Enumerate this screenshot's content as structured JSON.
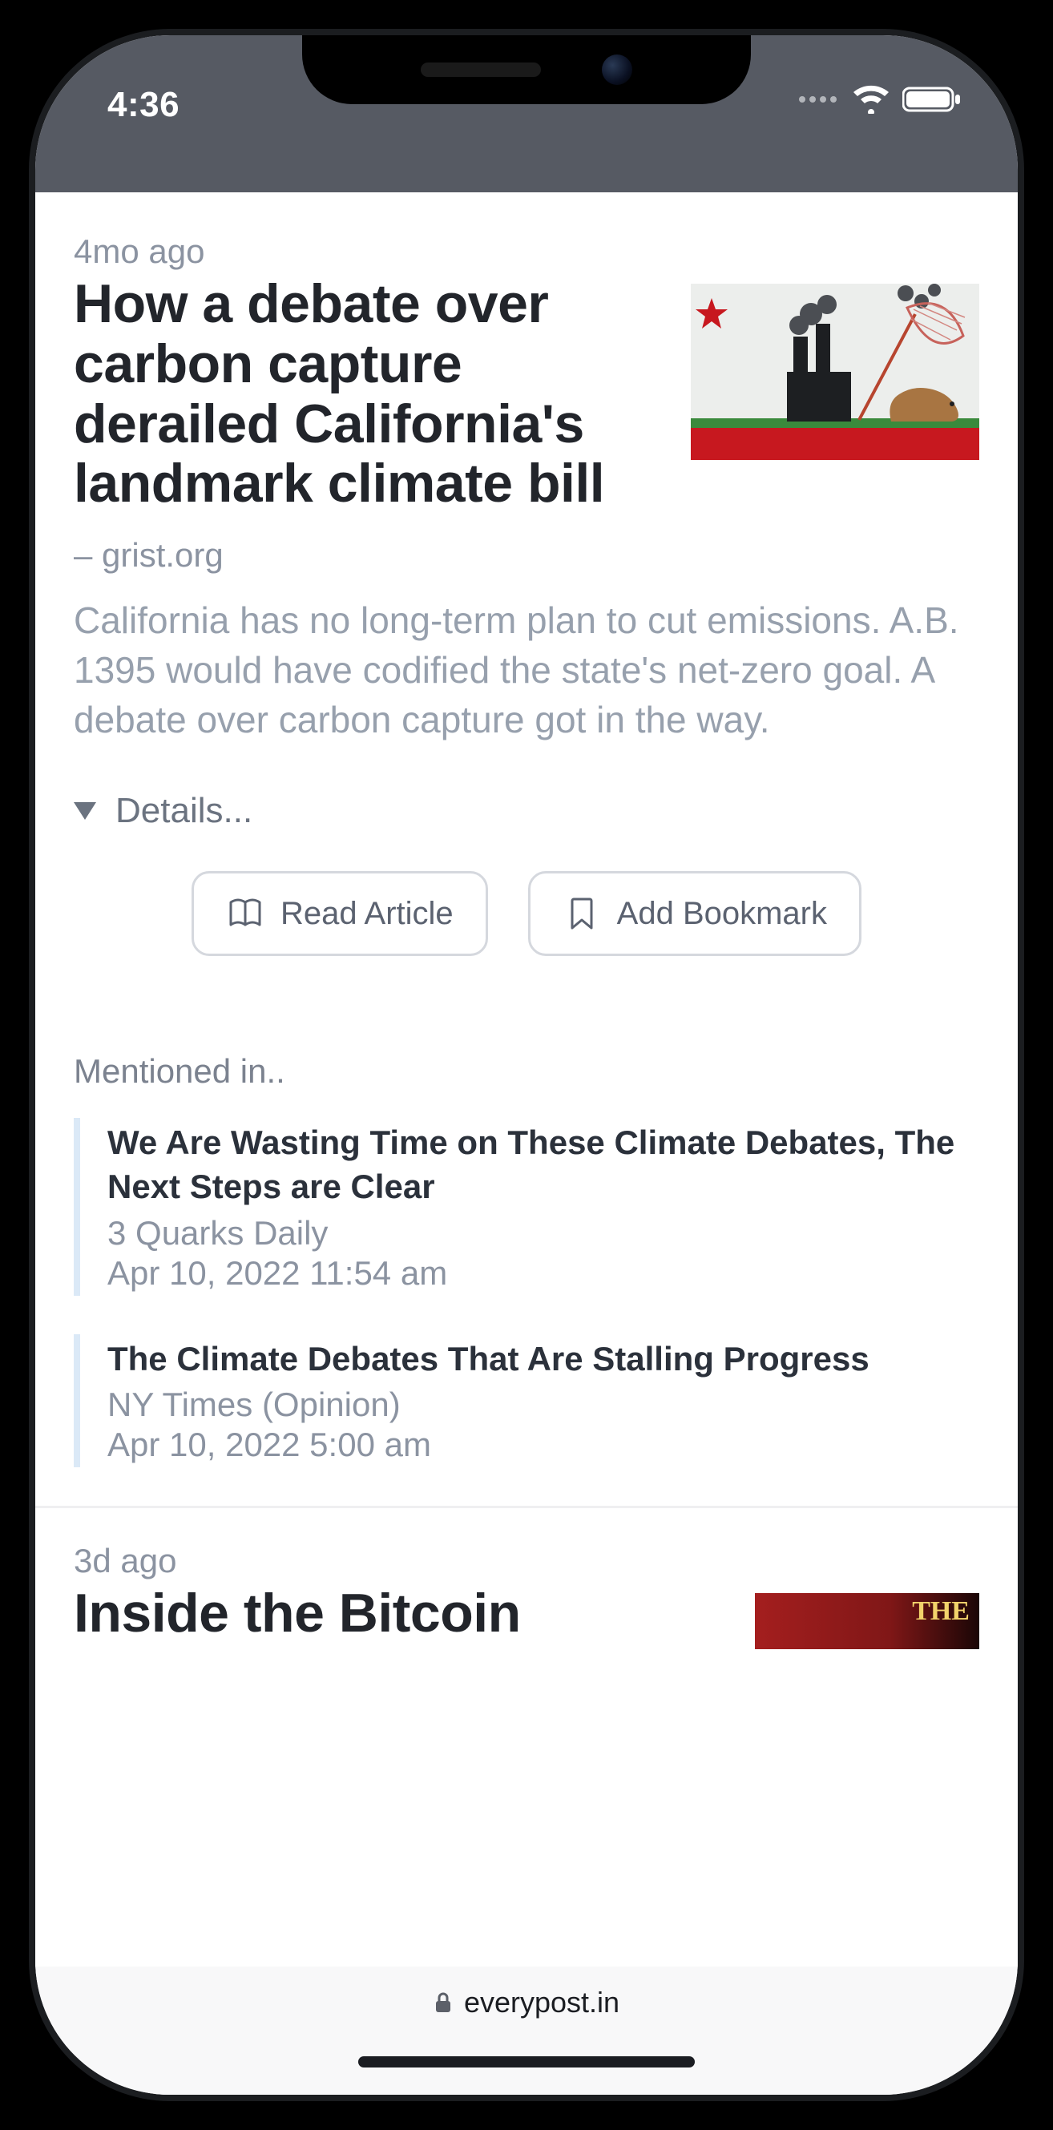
{
  "status": {
    "time": "4:36"
  },
  "article": {
    "age": "4mo ago",
    "headline": "How a debate over carbon capture derailed California's landmark climate bill",
    "source_prefix": "– ",
    "source": "grist.org",
    "summary": "California has no long-term plan to cut emissions. A.B. 1395 would have codified the state's net-zero goal. A debate over carbon capture got in the way.",
    "details_label": "Details...",
    "actions": {
      "read": "Read Article",
      "bookmark": "Add Bookmark"
    }
  },
  "mentions": {
    "section_label": "Mentioned in..",
    "items": [
      {
        "title": "We Are Wasting Time on These Climate Debates, The Next Steps are Clear",
        "source": "3 Quarks Daily",
        "timestamp": "Apr 10, 2022 11:54 am"
      },
      {
        "title": "The Climate Debates That Are Stalling Progress",
        "source": "NY Times (Opinion)",
        "timestamp": "Apr 10, 2022 5:00 am"
      }
    ]
  },
  "next_article": {
    "age": "3d ago",
    "headline": "Inside the Bitcoin"
  },
  "browser": {
    "domain": "everypost.in"
  }
}
